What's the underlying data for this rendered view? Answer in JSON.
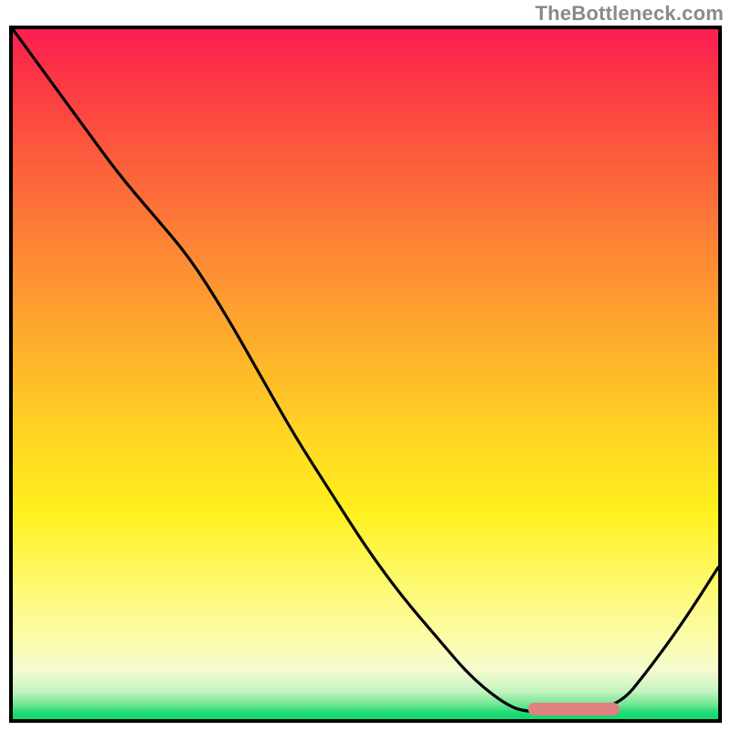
{
  "watermark_text": "TheBottleneck.com",
  "colors": {
    "border": "#000000",
    "watermark": "#8a8a8a",
    "marker": "#e08080",
    "gradient_top": "#fb1e52",
    "gradient_bottom": "#0fd86f"
  },
  "chart_data": {
    "type": "line",
    "title": "",
    "xlabel": "",
    "ylabel": "",
    "xlim": [
      0,
      100
    ],
    "ylim": [
      0,
      100
    ],
    "grid": false,
    "note": "Axes unlabeled; values estimated from pixel positions. y runs 0 at bottom to 100 at top.",
    "series": [
      {
        "name": "bottleneck_curve",
        "x": [
          0,
          5,
          10,
          15,
          20,
          25,
          30,
          35,
          40,
          45,
          50,
          55,
          60,
          65,
          70,
          73,
          80,
          86,
          90,
          95,
          100
        ],
        "y": [
          100,
          93,
          86,
          79,
          73,
          67,
          59,
          50,
          41,
          33,
          25,
          18,
          12,
          6,
          2,
          1,
          1,
          2,
          7,
          14,
          22
        ]
      }
    ],
    "marker": {
      "name": "optimal-range",
      "x_start": 73,
      "x_end": 86,
      "y": 1.5
    }
  }
}
